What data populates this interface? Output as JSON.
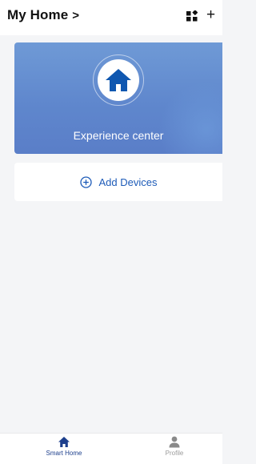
{
  "header": {
    "home_title": "My Home",
    "chevron": ">",
    "add_symbol": "+",
    "icons": {
      "chevron": "chevron-right-icon",
      "grid": "grid-layout-icon",
      "add": "plus-icon"
    }
  },
  "experience": {
    "label": "Experience center",
    "icon": "house-icon"
  },
  "add_devices": {
    "label": "Add Devices",
    "icon": "plus-circle-icon"
  },
  "tabbar": {
    "tabs": [
      {
        "label": "Smart Home",
        "icon": "house-icon",
        "active": true
      },
      {
        "label": "Profile",
        "icon": "person-icon",
        "active": false
      }
    ]
  },
  "colors": {
    "accent": "#1d5bb8",
    "card_gradient_top": "#6f9ad6",
    "card_gradient_bottom": "#5a7ec8",
    "tab_active": "#1d3f8c",
    "tab_inactive": "#9a9a9a",
    "background": "#f4f5f7"
  }
}
